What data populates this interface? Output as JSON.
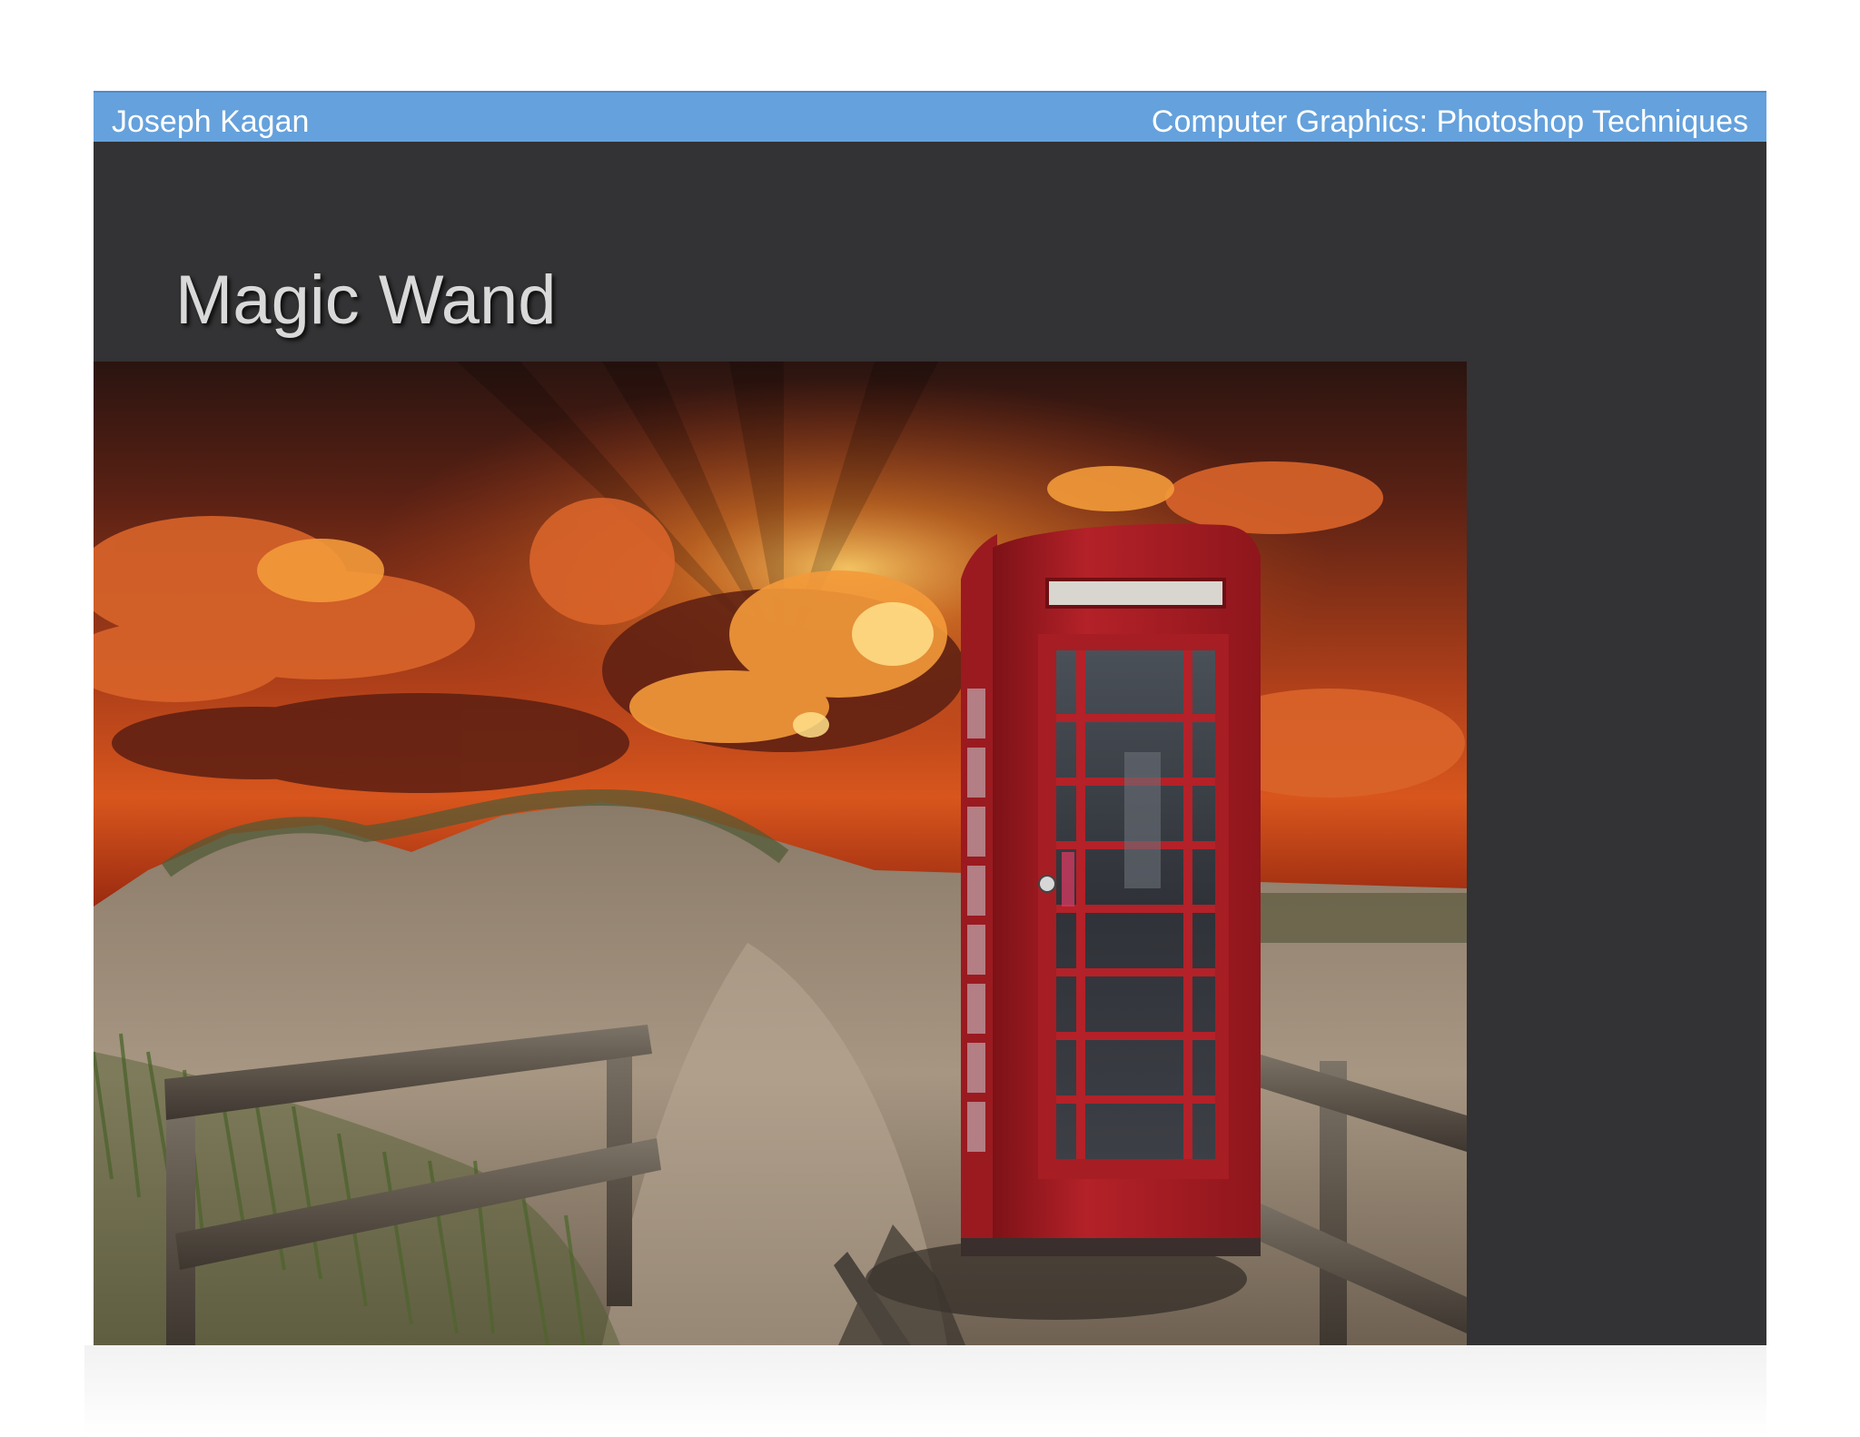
{
  "header": {
    "author": "Joseph Kagan",
    "course": "Computer Graphics: Photoshop Techniques"
  },
  "slide": {
    "title": "Magic Wand"
  },
  "image": {
    "subject": "red-telephone-booth-on-beach-dunes-at-sunset",
    "colors": {
      "slide_background": "#333234",
      "header_bar": "#65a1dc",
      "booth_red": "#b01e24",
      "sky_orange": "#c7461a"
    }
  }
}
